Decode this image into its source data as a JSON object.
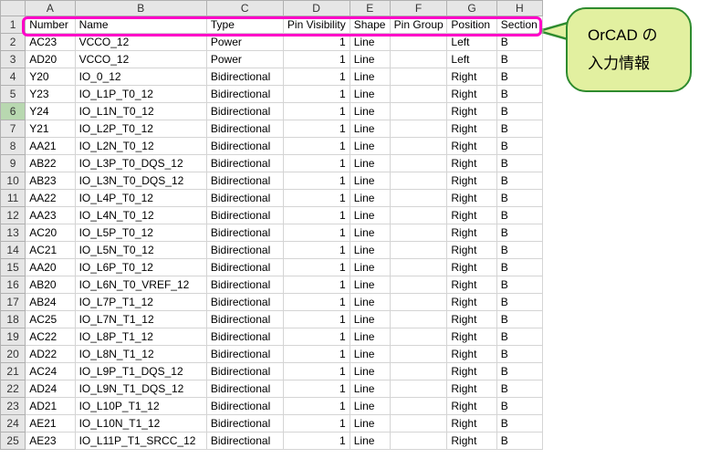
{
  "columns": [
    "A",
    "B",
    "C",
    "D",
    "E",
    "F",
    "G",
    "H"
  ],
  "headers": {
    "A": "Number",
    "B": "Name",
    "C": "Type",
    "D": "Pin Visibility",
    "E": "Shape",
    "F": "Pin Group",
    "G": "Position",
    "H": "Section"
  },
  "rows": [
    {
      "n": "1"
    },
    {
      "n": "2",
      "A": "AC23",
      "B": "VCCO_12",
      "C": "Power",
      "D": "1",
      "E": "Line",
      "F": "",
      "G": "Left",
      "H": "B"
    },
    {
      "n": "3",
      "A": "AD20",
      "B": "VCCO_12",
      "C": "Power",
      "D": "1",
      "E": "Line",
      "F": "",
      "G": "Left",
      "H": "B"
    },
    {
      "n": "4",
      "A": "Y20",
      "B": "IO_0_12",
      "C": "Bidirectional",
      "D": "1",
      "E": "Line",
      "F": "",
      "G": "Right",
      "H": "B"
    },
    {
      "n": "5",
      "A": "Y23",
      "B": "IO_L1P_T0_12",
      "C": "Bidirectional",
      "D": "1",
      "E": "Line",
      "F": "",
      "G": "Right",
      "H": "B"
    },
    {
      "n": "6",
      "A": "Y24",
      "B": "IO_L1N_T0_12",
      "C": "Bidirectional",
      "D": "1",
      "E": "Line",
      "F": "",
      "G": "Right",
      "H": "B"
    },
    {
      "n": "7",
      "A": "Y21",
      "B": "IO_L2P_T0_12",
      "C": "Bidirectional",
      "D": "1",
      "E": "Line",
      "F": "",
      "G": "Right",
      "H": "B"
    },
    {
      "n": "8",
      "A": "AA21",
      "B": "IO_L2N_T0_12",
      "C": "Bidirectional",
      "D": "1",
      "E": "Line",
      "F": "",
      "G": "Right",
      "H": "B"
    },
    {
      "n": "9",
      "A": "AB22",
      "B": "IO_L3P_T0_DQS_12",
      "C": "Bidirectional",
      "D": "1",
      "E": "Line",
      "F": "",
      "G": "Right",
      "H": "B"
    },
    {
      "n": "10",
      "A": "AB23",
      "B": "IO_L3N_T0_DQS_12",
      "C": "Bidirectional",
      "D": "1",
      "E": "Line",
      "F": "",
      "G": "Right",
      "H": "B"
    },
    {
      "n": "11",
      "A": "AA22",
      "B": "IO_L4P_T0_12",
      "C": "Bidirectional",
      "D": "1",
      "E": "Line",
      "F": "",
      "G": "Right",
      "H": "B"
    },
    {
      "n": "12",
      "A": "AA23",
      "B": "IO_L4N_T0_12",
      "C": "Bidirectional",
      "D": "1",
      "E": "Line",
      "F": "",
      "G": "Right",
      "H": "B"
    },
    {
      "n": "13",
      "A": "AC20",
      "B": "IO_L5P_T0_12",
      "C": "Bidirectional",
      "D": "1",
      "E": "Line",
      "F": "",
      "G": "Right",
      "H": "B"
    },
    {
      "n": "14",
      "A": "AC21",
      "B": "IO_L5N_T0_12",
      "C": "Bidirectional",
      "D": "1",
      "E": "Line",
      "F": "",
      "G": "Right",
      "H": "B"
    },
    {
      "n": "15",
      "A": "AA20",
      "B": "IO_L6P_T0_12",
      "C": "Bidirectional",
      "D": "1",
      "E": "Line",
      "F": "",
      "G": "Right",
      "H": "B"
    },
    {
      "n": "16",
      "A": "AB20",
      "B": "IO_L6N_T0_VREF_12",
      "C": "Bidirectional",
      "D": "1",
      "E": "Line",
      "F": "",
      "G": "Right",
      "H": "B"
    },
    {
      "n": "17",
      "A": "AB24",
      "B": "IO_L7P_T1_12",
      "C": "Bidirectional",
      "D": "1",
      "E": "Line",
      "F": "",
      "G": "Right",
      "H": "B"
    },
    {
      "n": "18",
      "A": "AC25",
      "B": "IO_L7N_T1_12",
      "C": "Bidirectional",
      "D": "1",
      "E": "Line",
      "F": "",
      "G": "Right",
      "H": "B"
    },
    {
      "n": "19",
      "A": "AC22",
      "B": "IO_L8P_T1_12",
      "C": "Bidirectional",
      "D": "1",
      "E": "Line",
      "F": "",
      "G": "Right",
      "H": "B"
    },
    {
      "n": "20",
      "A": "AD22",
      "B": "IO_L8N_T1_12",
      "C": "Bidirectional",
      "D": "1",
      "E": "Line",
      "F": "",
      "G": "Right",
      "H": "B"
    },
    {
      "n": "21",
      "A": "AC24",
      "B": "IO_L9P_T1_DQS_12",
      "C": "Bidirectional",
      "D": "1",
      "E": "Line",
      "F": "",
      "G": "Right",
      "H": "B"
    },
    {
      "n": "22",
      "A": "AD24",
      "B": "IO_L9N_T1_DQS_12",
      "C": "Bidirectional",
      "D": "1",
      "E": "Line",
      "F": "",
      "G": "Right",
      "H": "B"
    },
    {
      "n": "23",
      "A": "AD21",
      "B": "IO_L10P_T1_12",
      "C": "Bidirectional",
      "D": "1",
      "E": "Line",
      "F": "",
      "G": "Right",
      "H": "B"
    },
    {
      "n": "24",
      "A": "AE21",
      "B": "IO_L10N_T1_12",
      "C": "Bidirectional",
      "D": "1",
      "E": "Line",
      "F": "",
      "G": "Right",
      "H": "B"
    },
    {
      "n": "25",
      "A": "AE23",
      "B": "IO_L11P_T1_SRCC_12",
      "C": "Bidirectional",
      "D": "1",
      "E": "Line",
      "F": "",
      "G": "Right",
      "H": "B"
    }
  ],
  "selected_row": "6",
  "callout": {
    "line1": "OrCAD の",
    "line2": "入力情報"
  }
}
